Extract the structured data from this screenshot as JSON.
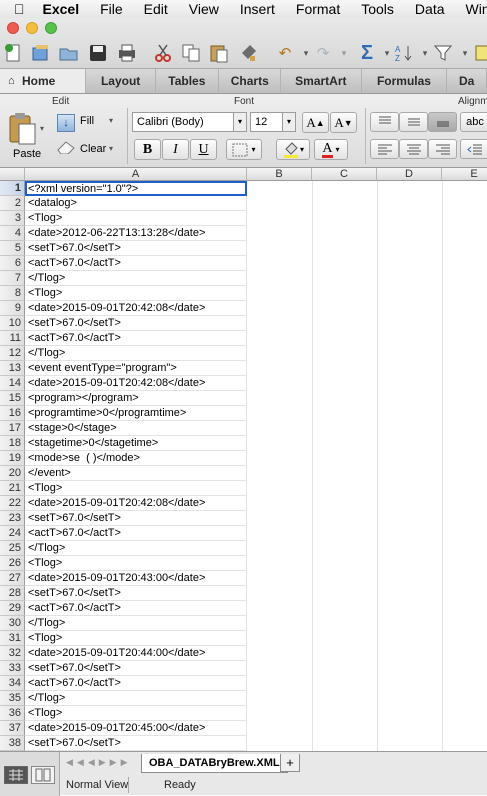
{
  "menubar": {
    "app": "Excel",
    "items": [
      "File",
      "Edit",
      "View",
      "Insert",
      "Format",
      "Tools",
      "Data",
      "Win"
    ]
  },
  "tabs": [
    "Home",
    "Layout",
    "Tables",
    "Charts",
    "SmartArt",
    "Formulas",
    "Da"
  ],
  "ribbon": {
    "edit_label": "Edit",
    "font_label": "Font",
    "align_label": "Alignm",
    "paste": "Paste",
    "fill": "Fill",
    "clear": "Clear",
    "font_name": "Calibri (Body)",
    "font_size": "12",
    "bold": "B",
    "italic": "I",
    "underline": "U",
    "grow": "A",
    "shrink": "A",
    "wrap": "abc"
  },
  "columns": [
    "A",
    "B",
    "C",
    "D",
    "E"
  ],
  "rows": [
    "<?xml version=\"1.0\"?>",
    "<datalog>",
    "<Tlog>",
    "<date>2012-06-22T13:13:28</date>",
    "<setT>67.0</setT>",
    "<actT>67.0</actT>",
    "</Tlog>",
    "<Tlog>",
    "<date>2015-09-01T20:42:08</date>",
    "<setT>67.0</setT>",
    "<actT>67.0</actT>",
    "</Tlog>",
    "<event eventType=\"program\">",
    "<date>2015-09-01T20:42:08</date>",
    "<program></program>",
    "<programtime>0</programtime>",
    "<stage>0</stage>",
    "<stagetime>0</stagetime>",
    "<mode>se  ( )</mode>",
    "</event>",
    "<Tlog>",
    "<date>2015-09-01T20:42:08</date>",
    "<setT>67.0</setT>",
    "<actT>67.0</actT>",
    "</Tlog>",
    "<Tlog>",
    "<date>2015-09-01T20:43:00</date>",
    "<setT>67.0</setT>",
    "<actT>67.0</actT>",
    "</Tlog>",
    "<Tlog>",
    "<date>2015-09-01T20:44:00</date>",
    "<setT>67.0</setT>",
    "<actT>67.0</actT>",
    "</Tlog>",
    "<Tlog>",
    "<date>2015-09-01T20:45:00</date>",
    "<setT>67.0</setT>"
  ],
  "sheet_tab": "OBA_DATABryBrew.XML",
  "add_sheet": "+",
  "status": {
    "view": "Normal View",
    "state": "Ready"
  }
}
